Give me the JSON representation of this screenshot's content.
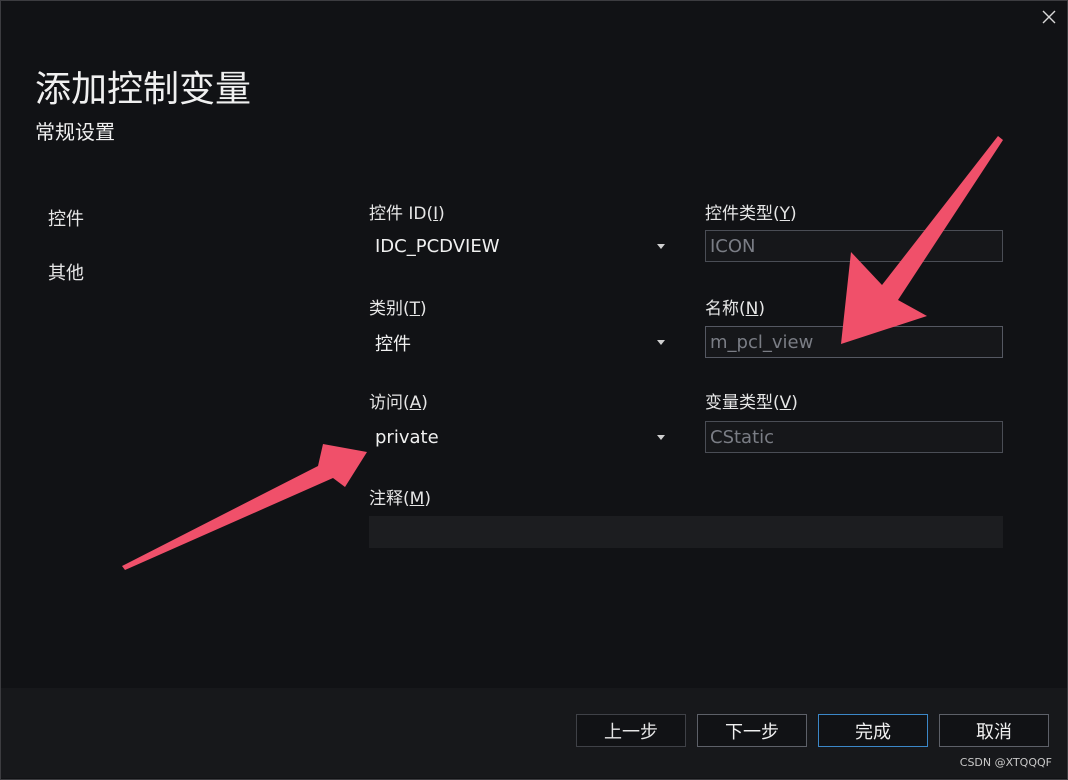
{
  "dialog": {
    "title": "添加控制变量",
    "subtitle": "常规设置",
    "close_icon": "close-icon"
  },
  "nav": {
    "items": [
      {
        "label": "控件"
      },
      {
        "label": "其他"
      }
    ]
  },
  "form": {
    "control_id": {
      "label": "控件 ID",
      "hotkey": "I",
      "value": "IDC_PCDVIEW"
    },
    "control_type": {
      "label": "控件类型",
      "hotkey": "Y",
      "value": "ICON"
    },
    "category": {
      "label": "类别",
      "hotkey": "T",
      "value": "控件"
    },
    "name": {
      "label": "名称",
      "hotkey": "N",
      "value": "m_pcl_view"
    },
    "access": {
      "label": "访问",
      "hotkey": "A",
      "value": "private"
    },
    "var_type": {
      "label": "变量类型",
      "hotkey": "V",
      "value": "CStatic"
    },
    "comment": {
      "label": "注释",
      "hotkey": "M",
      "value": ""
    }
  },
  "buttons": {
    "prev": "上一步",
    "next": "下一步",
    "finish": "完成",
    "cancel": "取消"
  },
  "watermark": "CSDN @XTQQQF",
  "colors": {
    "background": "#111215",
    "arrow": "#f0506a",
    "primary_border": "#3b87c8"
  }
}
